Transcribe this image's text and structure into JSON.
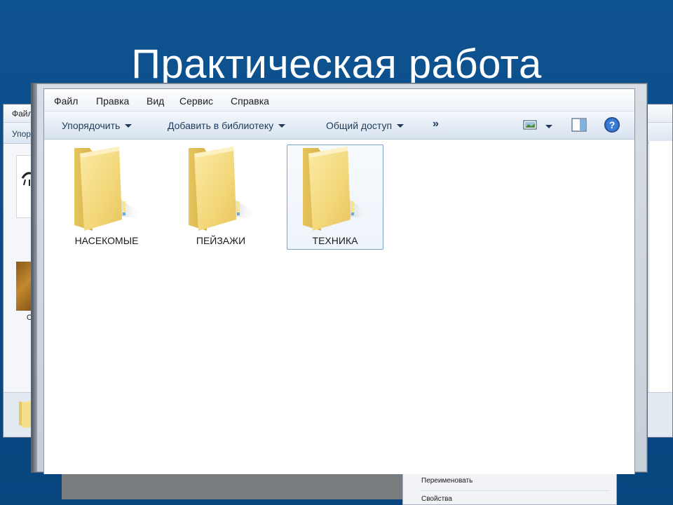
{
  "slide": {
    "title": "Практическая работа"
  },
  "background_window": {
    "menu_label": "Файл",
    "toolbar_label": "Упор",
    "thumb_label": "О"
  },
  "context_menu": {
    "items": [
      "Переименовать",
      "Свойства"
    ]
  },
  "main_window": {
    "menu": [
      "Файл",
      "Правка",
      "Вид",
      "Сервис",
      "Справка"
    ],
    "toolbar": {
      "organize": "Упорядочить",
      "add_to_library": "Добавить в библиотеку",
      "share": "Общий доступ",
      "more": "»"
    },
    "icons": {
      "view": "view-options-icon",
      "preview_pane": "preview-pane-icon",
      "help": "help-icon"
    },
    "folders": [
      {
        "name": "НАСЕКОМЫЕ",
        "selected": false
      },
      {
        "name": "ПЕЙЗАЖИ",
        "selected": false
      },
      {
        "name": "ТЕХНИКА",
        "selected": true
      }
    ]
  },
  "colors": {
    "slide_bg": "#0a4a86",
    "folder_yellow": "#f3d779",
    "selection_border": "#7da2ce",
    "toolbar_text": "#1e395b"
  }
}
